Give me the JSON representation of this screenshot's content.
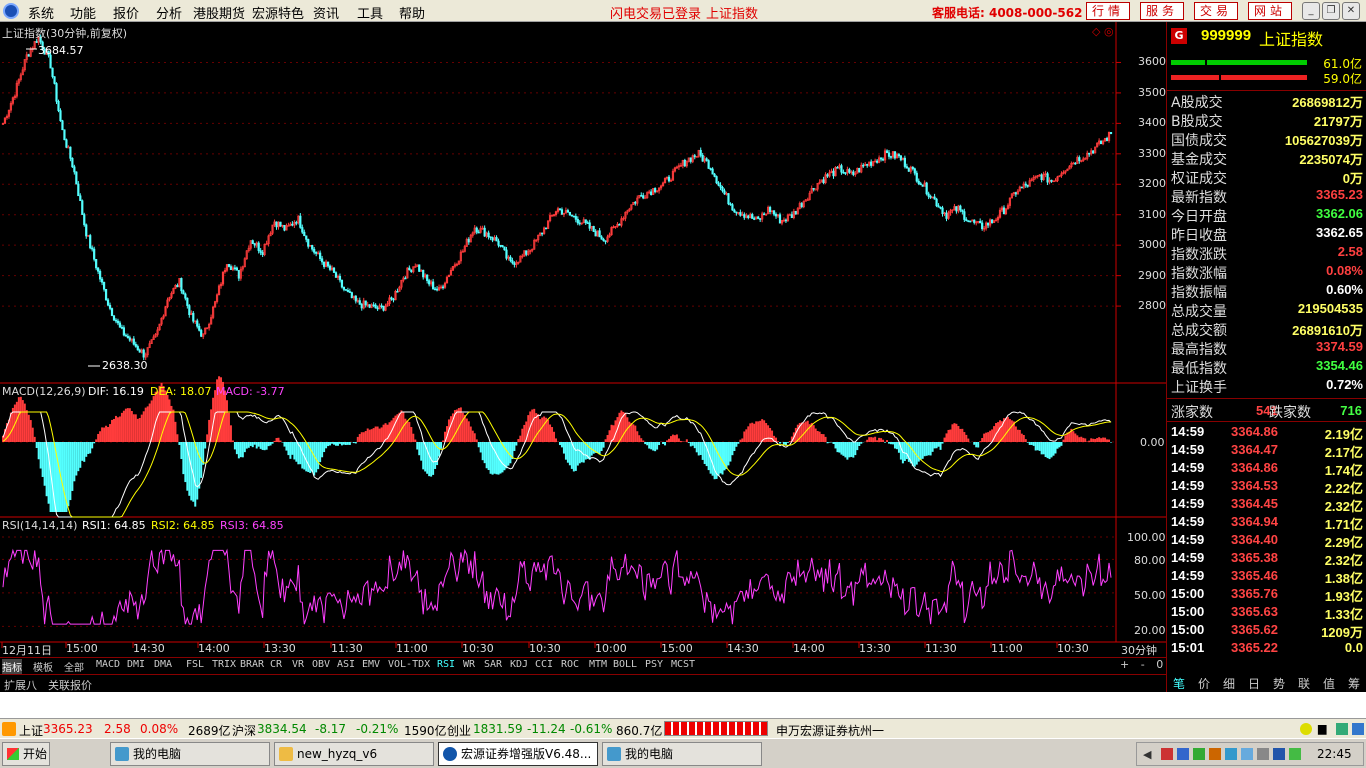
{
  "menu": {
    "items": [
      "系统",
      "功能",
      "报价",
      "分析",
      "港股期货",
      "宏源特色",
      "资讯",
      "工具",
      "帮助"
    ],
    "status1": "闪电交易已登录",
    "status2": "上证指数",
    "hotline": "客服电话: 4008-000-562",
    "buttons": [
      "行情",
      "服务",
      "交易",
      "网站"
    ]
  },
  "chart": {
    "title": "上证指数(30分钟,前复权)",
    "high_label": "3684.57",
    "low_label": "2638.30",
    "y_ticks": [
      "3600",
      "3500",
      "3400",
      "3300",
      "3200",
      "3100",
      "3000",
      "2900",
      "2800"
    ],
    "macd_label": "MACD(12,26,9)",
    "dif_label": "DIF: 16.19",
    "dea_label": "DEA: 18.07",
    "macd_val_label": "MACD: -3.77",
    "macd_zero": "0.00",
    "rsi_label": "RSI(14,14,14)",
    "rsi1_label": "RSI1: 64.85",
    "rsi2_label": "RSI2: 64.85",
    "rsi3_label": "RSI3: 64.85",
    "rsi_ticks": [
      "100.00",
      "80.00",
      "50.00",
      "20.00"
    ],
    "x_labels": [
      "12月11日",
      "15:00",
      "14:30",
      "14:00",
      "13:30",
      "11:30",
      "11:00",
      "10:30",
      "10:30",
      "10:00",
      "15:00",
      "14:30",
      "14:00",
      "13:30",
      "11:30",
      "11:00",
      "10:30"
    ],
    "period": "30分钟",
    "zoom": [
      "+",
      "-",
      "0"
    ],
    "colors": {
      "up": "#ff3c3c",
      "down": "#54ffff",
      "dif": "#ffffff",
      "dea": "#ffff00",
      "macd": "#ff40ff",
      "rsi": "#ff40ff",
      "axis": "#c00000"
    }
  },
  "chart_data": {
    "type": "candlestick",
    "title": "上证指数(30分钟,前复权)",
    "ylim": [
      2600,
      3700
    ],
    "high": 3684.57,
    "low": 2638.3,
    "close_path": [
      3400,
      3500,
      3620,
      3684,
      3600,
      3380,
      3250,
      3050,
      2920,
      2800,
      2720,
      2680,
      2640,
      2700,
      2830,
      2880,
      2760,
      2700,
      2810,
      2950,
      2900,
      3020,
      2980,
      3080,
      3050,
      3090,
      3000,
      2950,
      2910,
      2850,
      2810,
      2800,
      2790,
      2820,
      2900,
      2940,
      2880,
      2850,
      2920,
      2980,
      3060,
      3040,
      3010,
      2940,
      2960,
      3000,
      3060,
      3120,
      3100,
      3080,
      3050,
      3020,
      3060,
      3120,
      3160,
      3180,
      3200,
      3240,
      3280,
      3300,
      3260,
      3180,
      3120,
      3100,
      3080,
      3120,
      3080,
      3100,
      3150,
      3200,
      3230,
      3250,
      3230,
      3260,
      3280,
      3300,
      3290,
      3250,
      3200,
      3150,
      3100,
      3120,
      3080,
      3060,
      3080,
      3120,
      3180,
      3200,
      3230,
      3210,
      3250,
      3280,
      3300,
      3330,
      3365
    ],
    "macd": {
      "dif": 16.19,
      "dea": 18.07,
      "macd": -3.77
    },
    "rsi": {
      "rsi1": 64.85,
      "rsi2": 64.85,
      "rsi3": 64.85,
      "ticks": [
        100,
        80,
        50,
        20
      ]
    }
  },
  "indicators": [
    "指标",
    "模板",
    "全部",
    "MACD",
    "DMI",
    "DMA",
    "FSL",
    "TRIX",
    "BRAR",
    "CR",
    "VR",
    "OBV",
    "ASI",
    "EMV",
    "VOL-TDX",
    "RSI",
    "WR",
    "SAR",
    "KDJ",
    "CCI",
    "ROC",
    "MTM",
    "BOLL",
    "PSY",
    "MCST"
  ],
  "ext_tabs": [
    "扩展八",
    "关联报价"
  ],
  "panel": {
    "code": "999999",
    "name": "上证指数",
    "g": "G",
    "bar1": "61.0亿",
    "bar2": "59.0亿",
    "rows": [
      {
        "k": "A股成交",
        "v": "26869812万",
        "c": "#ffff66"
      },
      {
        "k": "B股成交",
        "v": "21797万",
        "c": "#ffff66"
      },
      {
        "k": "国债成交",
        "v": "105627039万",
        "c": "#ffff66"
      },
      {
        "k": "基金成交",
        "v": "2235074万",
        "c": "#ffff66"
      },
      {
        "k": "权证成交",
        "v": "0万",
        "c": "#ffff66"
      },
      {
        "k": "最新指数",
        "v": "3365.23",
        "c": "#ff4040"
      },
      {
        "k": "今日开盘",
        "v": "3362.06",
        "c": "#40ff40"
      },
      {
        "k": "昨日收盘",
        "v": "3362.65",
        "c": "#ffffff"
      },
      {
        "k": "指数涨跌",
        "v": "2.58",
        "c": "#ff4040"
      },
      {
        "k": "指数涨幅",
        "v": "0.08%",
        "c": "#ff4040"
      },
      {
        "k": "指数振幅",
        "v": "0.60%",
        "c": "#ffffff"
      },
      {
        "k": "总成交量",
        "v": "219504535",
        "c": "#ffff66"
      },
      {
        "k": "总成交额",
        "v": "26891610万",
        "c": "#ffff66"
      },
      {
        "k": "最高指数",
        "v": "3374.59",
        "c": "#ff4040"
      },
      {
        "k": "最低指数",
        "v": "3354.46",
        "c": "#40ff40"
      },
      {
        "k": "上证换手",
        "v": "0.72%",
        "c": "#ffffff"
      }
    ],
    "rise_label": "涨家数",
    "rise": "541",
    "fall_label": "跌家数",
    "fall": "716",
    "ticks": [
      {
        "t": "14:59",
        "p": "3364.86",
        "v": "2.19亿",
        "c": "#ffff66"
      },
      {
        "t": "14:59",
        "p": "3364.47",
        "v": "2.17亿",
        "c": "#ffff66"
      },
      {
        "t": "14:59",
        "p": "3364.86",
        "v": "1.74亿",
        "c": "#ffff66"
      },
      {
        "t": "14:59",
        "p": "3364.53",
        "v": "2.22亿",
        "c": "#ffff66"
      },
      {
        "t": "14:59",
        "p": "3364.45",
        "v": "2.32亿",
        "c": "#ffff66"
      },
      {
        "t": "14:59",
        "p": "3364.94",
        "v": "1.71亿",
        "c": "#ffff66"
      },
      {
        "t": "14:59",
        "p": "3364.40",
        "v": "2.29亿",
        "c": "#ffff66"
      },
      {
        "t": "14:59",
        "p": "3365.38",
        "v": "2.32亿",
        "c": "#ffff66"
      },
      {
        "t": "14:59",
        "p": "3365.46",
        "v": "1.38亿",
        "c": "#ffff66"
      },
      {
        "t": "15:00",
        "p": "3365.76",
        "v": "1.93亿",
        "c": "#ffff66"
      },
      {
        "t": "15:00",
        "p": "3365.63",
        "v": "1.33亿",
        "c": "#ffff66"
      },
      {
        "t": "15:00",
        "p": "3365.62",
        "v": "1209万",
        "c": "#ffff66"
      },
      {
        "t": "15:01",
        "p": "3365.22",
        "v": "0.0",
        "c": "#ffff66"
      }
    ],
    "tabs": [
      "笔",
      "价",
      "细",
      "日",
      "势",
      "联",
      "值",
      "筹"
    ]
  },
  "quotebar": {
    "sh_name": "上证",
    "sh_price": "3365.23",
    "sh_chg": "2.58",
    "sh_pct": "0.08%",
    "sh_amt": "2689亿",
    "hs_name": "沪深",
    "hs_price": "3834.54",
    "hs_chg": "-8.17",
    "hs_pct": "-0.21%",
    "hs_amt": "1590亿",
    "cy_name": "创业",
    "cy_price": "1831.59",
    "cy_chg": "-11.24",
    "cy_pct": "-0.61%",
    "cy_amt": "860.7亿",
    "broker": "申万宏源证券杭州一"
  },
  "taskbar": {
    "start": "开始",
    "tasks": [
      "我的电脑",
      "new_hyzq_v6",
      "宏源证券增强版V6.48...",
      "我的电脑"
    ],
    "clock": "22:45"
  }
}
